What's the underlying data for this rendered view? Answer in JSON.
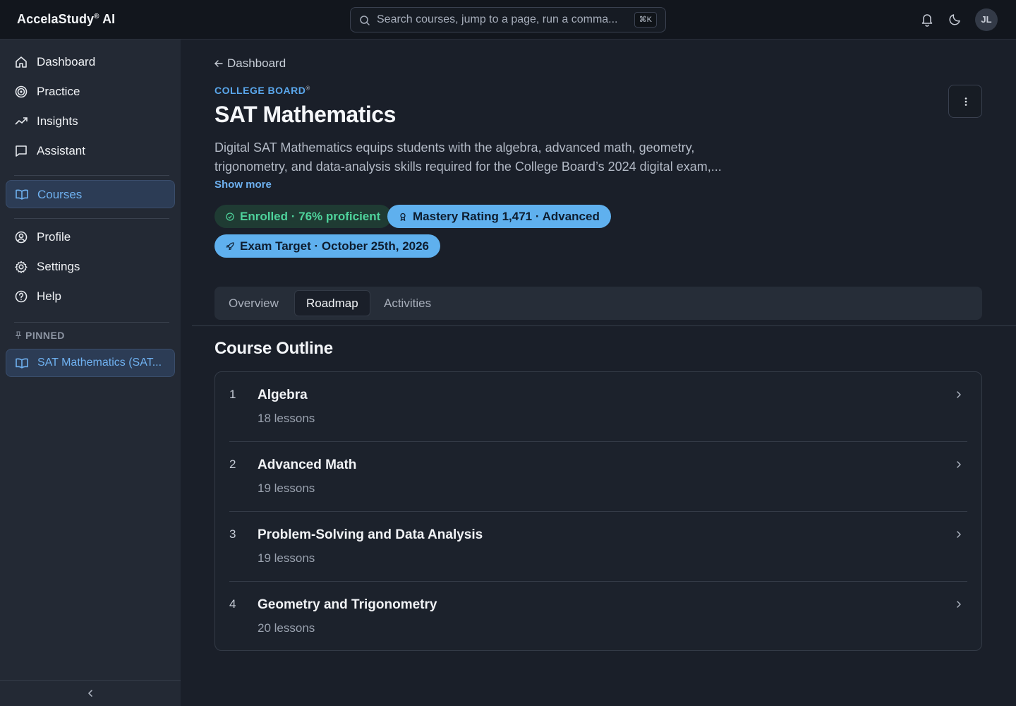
{
  "app": {
    "brand": "AccelaStudy",
    "brand_mark": "®",
    "brand_suffix": "AI"
  },
  "search": {
    "placeholder": "Search courses, jump to a page, run a comma...",
    "shortcut": "⌘K"
  },
  "user": {
    "initials": "JL"
  },
  "sidebar": {
    "items": [
      {
        "label": "Dashboard",
        "icon": "home-icon"
      },
      {
        "label": "Practice",
        "icon": "target-icon"
      },
      {
        "label": "Insights",
        "icon": "trending-up-icon"
      },
      {
        "label": "Assistant",
        "icon": "message-square-icon"
      },
      {
        "label": "Courses",
        "icon": "book-open-icon",
        "active": true
      },
      {
        "label": "Profile",
        "icon": "user-circle-icon"
      },
      {
        "label": "Settings",
        "icon": "gear-icon"
      },
      {
        "label": "Help",
        "icon": "help-circle-icon"
      }
    ],
    "pinned_heading": "PINNED",
    "pinned_item": "SAT Mathematics (SAT..."
  },
  "page": {
    "back_label": "Dashboard",
    "eyebrow": "COLLEGE BOARD",
    "eyebrow_mark": "®",
    "title": "SAT Mathematics",
    "description": "Digital SAT Mathematics equips students with the algebra, advanced math, geometry, trigonometry, and data-analysis skills required for the College Board’s 2024 digital exam,...",
    "show_more": "Show more",
    "chips": {
      "enrolled": "Enrolled · 76% proficient",
      "mastery": "Mastery Rating 1,471 · Advanced",
      "exam": "Exam Target · October 25th, 2026"
    },
    "tabs": [
      "Overview",
      "Roadmap",
      "Activities"
    ],
    "active_tab": "Roadmap",
    "section_title": "Course Outline",
    "outline": [
      {
        "num": "1",
        "name": "Algebra",
        "lessons": "18 lessons"
      },
      {
        "num": "2",
        "name": "Advanced Math",
        "lessons": "19 lessons"
      },
      {
        "num": "3",
        "name": "Problem-Solving and Data Analysis",
        "lessons": "19 lessons"
      },
      {
        "num": "4",
        "name": "Geometry and Trigonometry",
        "lessons": "20 lessons"
      }
    ]
  },
  "colors": {
    "accent": "#5fb0ee",
    "success": "#4ed29b",
    "background": "#1a1f29",
    "sidebar": "#232934"
  }
}
